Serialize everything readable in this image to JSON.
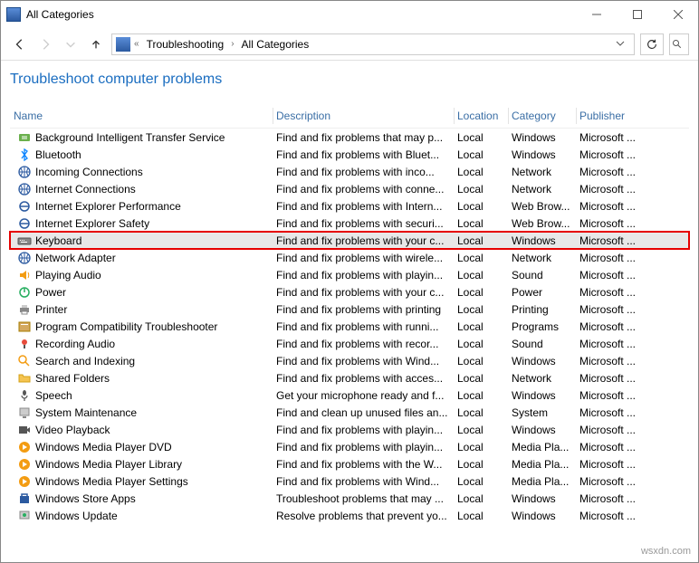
{
  "window": {
    "title": "All Categories",
    "breadcrumbs": [
      "Troubleshooting",
      "All Categories"
    ],
    "page_title": "Troubleshoot computer problems"
  },
  "columns": {
    "name": "Name",
    "description": "Description",
    "location": "Location",
    "category": "Category",
    "publisher": "Publisher"
  },
  "highlight_name": "Keyboard",
  "items": [
    {
      "name": "Background Intelligent Transfer Service",
      "desc": "Find and fix problems that may p...",
      "loc": "Local",
      "cat": "Windows",
      "pub": "Microsoft ...",
      "icon": "transfer"
    },
    {
      "name": "Bluetooth",
      "desc": "Find and fix problems with Bluet...",
      "loc": "Local",
      "cat": "Windows",
      "pub": "Microsoft ...",
      "icon": "bluetooth"
    },
    {
      "name": "Incoming Connections",
      "desc": "Find and fix problems with inco...",
      "loc": "Local",
      "cat": "Network",
      "pub": "Microsoft ...",
      "icon": "network"
    },
    {
      "name": "Internet Connections",
      "desc": "Find and fix problems with conne...",
      "loc": "Local",
      "cat": "Network",
      "pub": "Microsoft ...",
      "icon": "network"
    },
    {
      "name": "Internet Explorer Performance",
      "desc": "Find and fix problems with Intern...",
      "loc": "Local",
      "cat": "Web Brow...",
      "pub": "Microsoft ...",
      "icon": "ie"
    },
    {
      "name": "Internet Explorer Safety",
      "desc": "Find and fix problems with securi...",
      "loc": "Local",
      "cat": "Web Brow...",
      "pub": "Microsoft ...",
      "icon": "ie"
    },
    {
      "name": "Keyboard",
      "desc": "Find and fix problems with your c...",
      "loc": "Local",
      "cat": "Windows",
      "pub": "Microsoft ...",
      "icon": "keyboard"
    },
    {
      "name": "Network Adapter",
      "desc": "Find and fix problems with wirele...",
      "loc": "Local",
      "cat": "Network",
      "pub": "Microsoft ...",
      "icon": "network"
    },
    {
      "name": "Playing Audio",
      "desc": "Find and fix problems with playin...",
      "loc": "Local",
      "cat": "Sound",
      "pub": "Microsoft ...",
      "icon": "audio"
    },
    {
      "name": "Power",
      "desc": "Find and fix problems with your c...",
      "loc": "Local",
      "cat": "Power",
      "pub": "Microsoft ...",
      "icon": "power"
    },
    {
      "name": "Printer",
      "desc": "Find and fix problems with printing",
      "loc": "Local",
      "cat": "Printing",
      "pub": "Microsoft ...",
      "icon": "printer"
    },
    {
      "name": "Program Compatibility Troubleshooter",
      "desc": "Find and fix problems with runni...",
      "loc": "Local",
      "cat": "Programs",
      "pub": "Microsoft ...",
      "icon": "program"
    },
    {
      "name": "Recording Audio",
      "desc": "Find and fix problems with recor...",
      "loc": "Local",
      "cat": "Sound",
      "pub": "Microsoft ...",
      "icon": "recording"
    },
    {
      "name": "Search and Indexing",
      "desc": "Find and fix problems with Wind...",
      "loc": "Local",
      "cat": "Windows",
      "pub": "Microsoft ...",
      "icon": "search"
    },
    {
      "name": "Shared Folders",
      "desc": "Find and fix problems with acces...",
      "loc": "Local",
      "cat": "Network",
      "pub": "Microsoft ...",
      "icon": "folder"
    },
    {
      "name": "Speech",
      "desc": "Get your microphone ready and f...",
      "loc": "Local",
      "cat": "Windows",
      "pub": "Microsoft ...",
      "icon": "speech"
    },
    {
      "name": "System Maintenance",
      "desc": "Find and clean up unused files an...",
      "loc": "Local",
      "cat": "System",
      "pub": "Microsoft ...",
      "icon": "system"
    },
    {
      "name": "Video Playback",
      "desc": "Find and fix problems with playin...",
      "loc": "Local",
      "cat": "Windows",
      "pub": "Microsoft ...",
      "icon": "video"
    },
    {
      "name": "Windows Media Player DVD",
      "desc": "Find and fix problems with playin...",
      "loc": "Local",
      "cat": "Media Pla...",
      "pub": "Microsoft ...",
      "icon": "wmp"
    },
    {
      "name": "Windows Media Player Library",
      "desc": "Find and fix problems with the W...",
      "loc": "Local",
      "cat": "Media Pla...",
      "pub": "Microsoft ...",
      "icon": "wmp"
    },
    {
      "name": "Windows Media Player Settings",
      "desc": "Find and fix problems with Wind...",
      "loc": "Local",
      "cat": "Media Pla...",
      "pub": "Microsoft ...",
      "icon": "wmp"
    },
    {
      "name": "Windows Store Apps",
      "desc": "Troubleshoot problems that may ...",
      "loc": "Local",
      "cat": "Windows",
      "pub": "Microsoft ...",
      "icon": "store"
    },
    {
      "name": "Windows Update",
      "desc": "Resolve problems that prevent yo...",
      "loc": "Local",
      "cat": "Windows",
      "pub": "Microsoft ...",
      "icon": "update"
    }
  ],
  "watermark": "wsxdn.com"
}
